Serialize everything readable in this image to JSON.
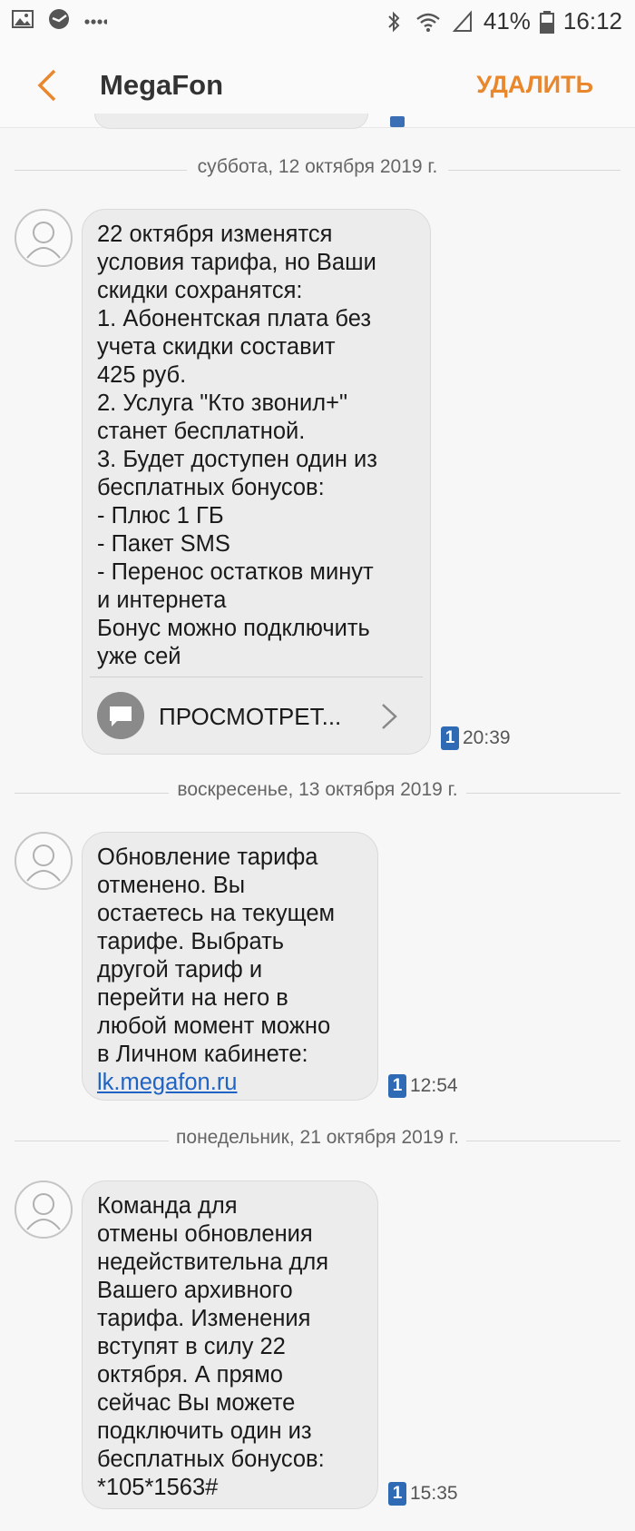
{
  "status_bar": {
    "battery_percent": "41%",
    "time": "16:12",
    "icons": [
      "gallery-icon",
      "sberbank-icon",
      "more-dots-icon",
      "bluetooth-icon",
      "wifi-icon",
      "signal-icon",
      "battery-icon"
    ]
  },
  "header": {
    "title": "MegaFon",
    "delete_label": "УДАЛИТЬ",
    "accent_color": "#e8872c"
  },
  "threads": [
    {
      "date_label": "суббота, 12 октября 2019 г.",
      "text": "22 октября изменятся\nусловия тарифа, но Ваши\nскидки сохранятся:\n1. Абонентская плата без\nучета скидки составит\n425 руб.\n2. Услуга \"Кто звонил+\"\nстанет бесплатной.\n3. Будет доступен один из\nбесплатных бонусов:\n- Плюс 1 ГБ\n- Пакет SMS\n- Перенос остатков минут\nи интернета\nБонус можно подключить\nуже сей",
      "view_label": "ПРОСМОТРЕТ...",
      "sim": "1",
      "time": "20:39"
    },
    {
      "date_label": "воскресенье, 13 октября 2019 г.",
      "text": "Обновление тарифа\nотменено. Вы\nостаетесь на текущем\nтарифе. Выбрать\nдругой тариф и\nперейти на него в\nлюбой момент можно\nв Личном кабинете:",
      "link": "lk.megafon.ru",
      "sim": "1",
      "time": "12:54"
    },
    {
      "date_label": "понедельник, 21 октября 2019 г.",
      "text": "Команда для\nотмены обновления\nнедействительна для\nВашего архивного\nтарифа. Изменения\nвступят в силу 22\nоктября. А прямо\nсейчас Вы можете\nподключить один из\nбесплатных бонусов:\n*105*1563#",
      "sim": "1",
      "time": "15:35"
    }
  ]
}
